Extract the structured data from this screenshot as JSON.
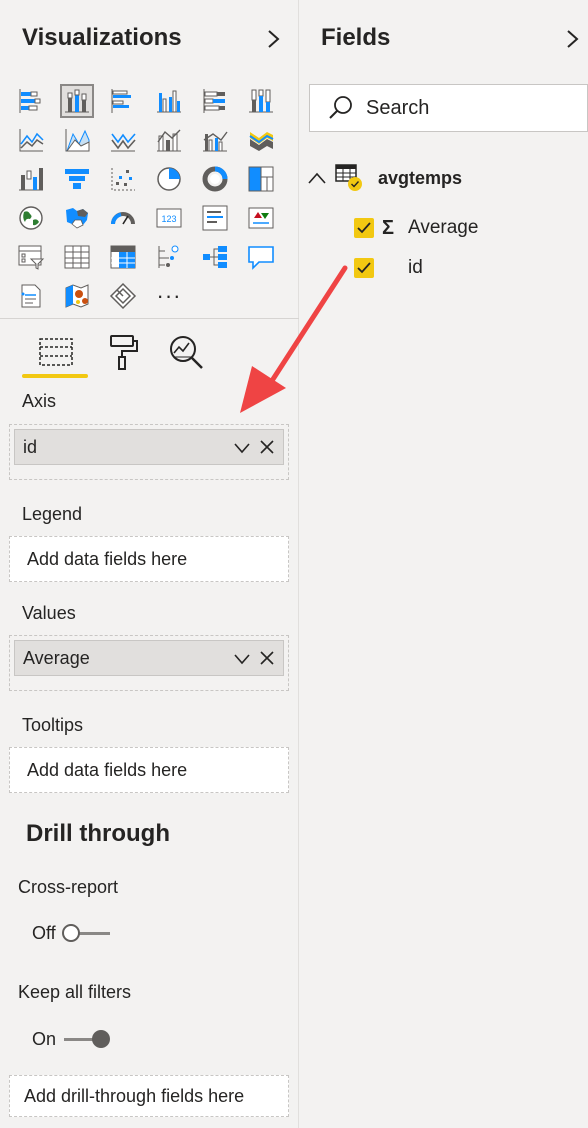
{
  "visualizations": {
    "title": "Visualizations",
    "icons": [
      "stacked-bar-chart-icon",
      "stacked-column-chart-icon",
      "clustered-bar-chart-icon",
      "clustered-column-chart-icon",
      "100-stacked-bar-chart-icon",
      "100-stacked-column-chart-icon",
      "line-chart-icon",
      "area-chart-icon",
      "stacked-area-chart-icon",
      "line-and-stacked-column-icon",
      "line-and-clustered-column-icon",
      "ribbon-chart-icon",
      "waterfall-chart-icon",
      "funnel-icon",
      "scatter-chart-icon",
      "pie-chart-icon",
      "donut-chart-icon",
      "treemap-icon",
      "map-icon",
      "filled-map-icon",
      "gauge-icon",
      "card-icon",
      "multi-row-card-icon",
      "kpi-icon",
      "slicer-icon",
      "table-icon",
      "matrix-icon",
      "key-influencers-icon",
      "decomposition-tree-icon",
      "qa-icon",
      "smart-narrative-icon",
      "azure-map-icon",
      "power-apps-icon",
      "more-visuals-icon"
    ],
    "selected_icon_index": 1,
    "card_label": "123",
    "more_label": "···"
  },
  "build_tabs": [
    "fields-tab-icon",
    "format-paint-roller-icon",
    "analytics-magnifier-icon"
  ],
  "wells": {
    "axis": {
      "label": "Axis",
      "field": "id"
    },
    "legend": {
      "label": "Legend",
      "placeholder": "Add data fields here"
    },
    "values": {
      "label": "Values",
      "field": "Average"
    },
    "tooltips": {
      "label": "Tooltips",
      "placeholder": "Add data fields here"
    }
  },
  "drill_through": {
    "title": "Drill through",
    "cross_report": {
      "label": "Cross-report",
      "state": "Off"
    },
    "keep_filters": {
      "label": "Keep all filters",
      "state": "On"
    },
    "add_placeholder": "Add drill-through fields here"
  },
  "fields": {
    "title": "Fields",
    "search_placeholder": "Search",
    "table": {
      "name": "avgtemps",
      "expanded": true
    },
    "items": [
      {
        "name": "Average",
        "checked": true,
        "sigma": "Σ"
      },
      {
        "name": "id",
        "checked": true
      }
    ]
  },
  "colors": {
    "accent": "#f2c811",
    "annotation_arrow": "#ef4444",
    "icon_blue": "#118dff"
  }
}
